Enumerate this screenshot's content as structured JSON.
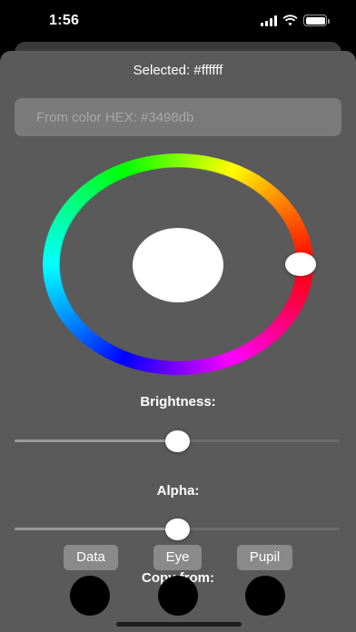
{
  "status_bar": {
    "time": "1:56"
  },
  "header": {
    "selected_label": "Selected:  #ffffff"
  },
  "hex_input": {
    "value": "",
    "placeholder": "From color HEX: #3498db"
  },
  "color_wheel": {
    "selected_color": "#ffffff"
  },
  "brightness": {
    "label": "Brightness:",
    "value": 0.5
  },
  "alpha": {
    "label": "Alpha:",
    "value": 0.5
  },
  "copy_from": {
    "label": "Copy from:",
    "buttons": [
      "Data",
      "Eye",
      "Pupil"
    ]
  },
  "colors": {
    "sheet_background": "#5a5a5a",
    "input_background": "#7a7a7a",
    "button_background": "#8a8a8a",
    "swatch": "#000000"
  }
}
